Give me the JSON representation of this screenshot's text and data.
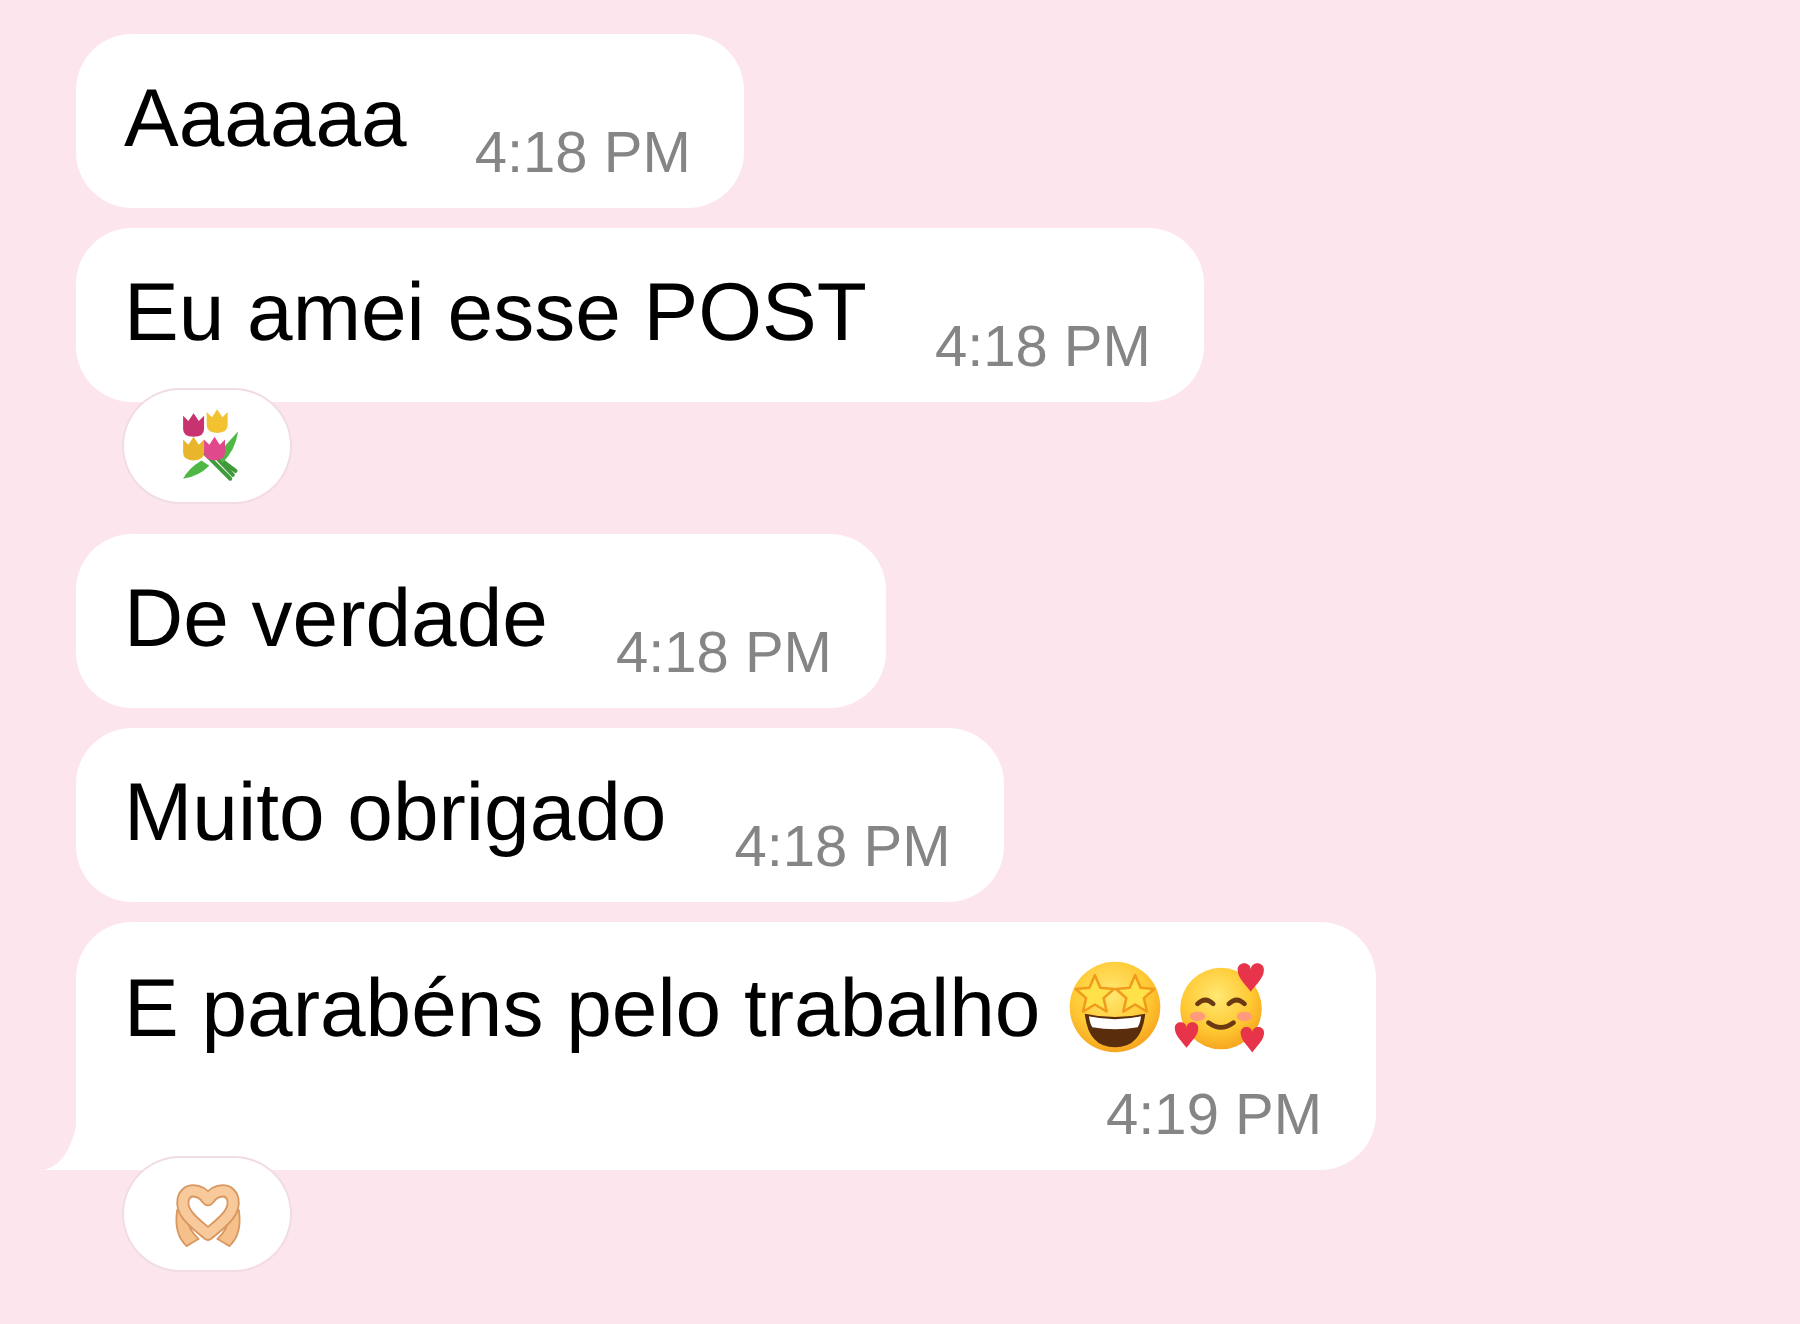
{
  "messages": [
    {
      "text": "Aaaaaa",
      "time": "4:18 PM"
    },
    {
      "text": "Eu amei esse POST",
      "time": "4:18 PM",
      "reaction": {
        "kind": "bouquet"
      }
    },
    {
      "text": "De verdade",
      "time": "4:18 PM"
    },
    {
      "text": "Muito obrigado",
      "time": "4:18 PM"
    },
    {
      "text": "E parabéns pelo trabalho",
      "emojis": [
        {
          "kind": "star-struck"
        },
        {
          "kind": "smiling-hearts"
        }
      ],
      "time": "4:19 PM",
      "tail": true,
      "reaction": {
        "kind": "heart-hands"
      }
    }
  ]
}
